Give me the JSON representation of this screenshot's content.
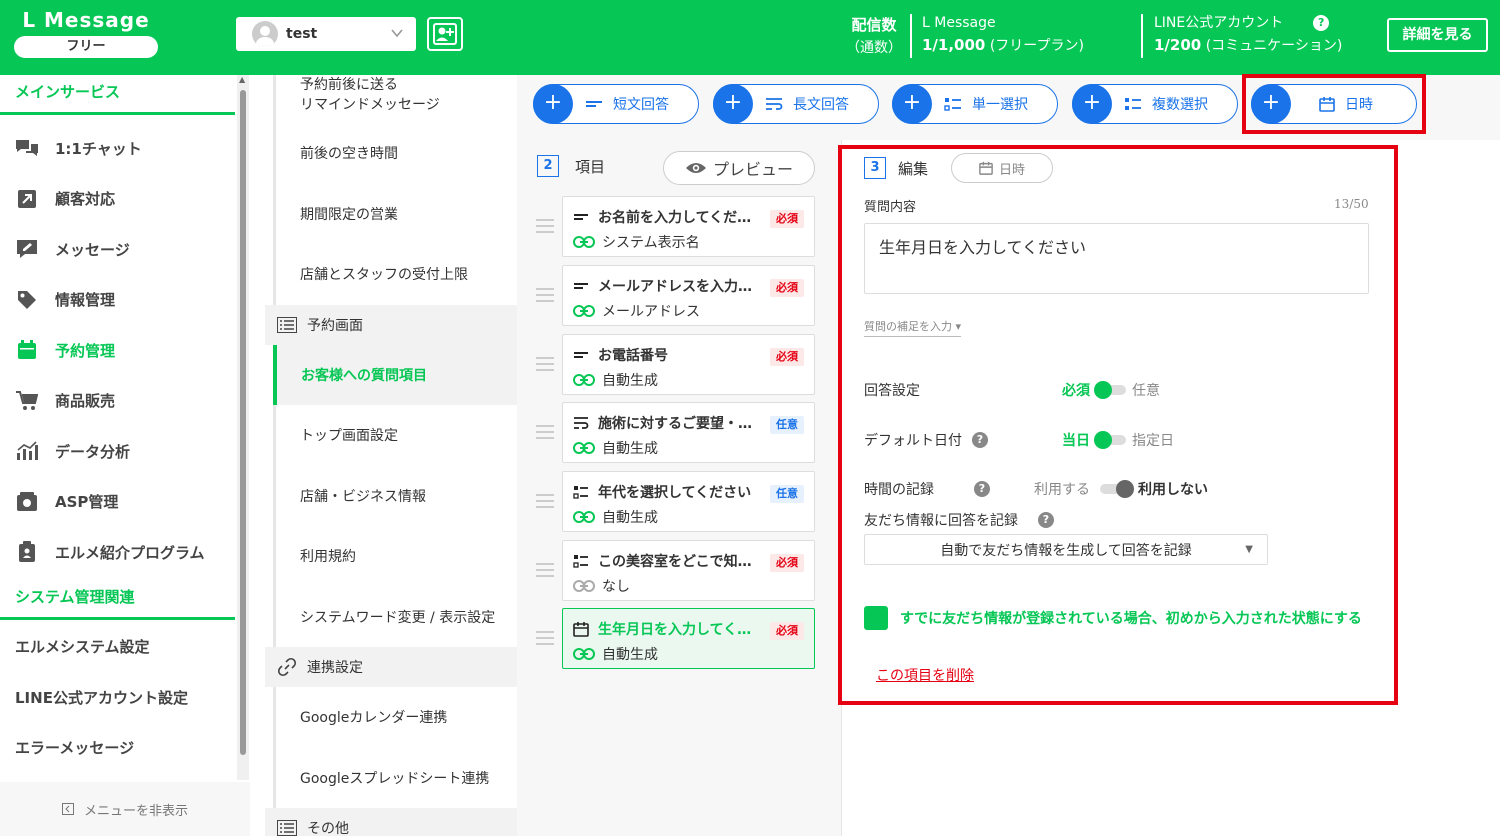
{
  "header": {
    "logo": "L Message",
    "plan_badge": "フリー",
    "account_name": "test",
    "delivery_label": "配信数",
    "delivery_sub": "（通数）",
    "lmessage_label": "L Message",
    "lmessage_value": "1/1,000",
    "lmessage_plan": "(フリープラン)",
    "line_label": "LINE公式アカウント",
    "line_value": "1/200",
    "line_plan": "(コミュニケーション)",
    "details_button": "詳細を見る"
  },
  "sidebar": {
    "section_main": "メインサービス",
    "items": [
      {
        "label": "1:1チャット",
        "icon": "chat-icon"
      },
      {
        "label": "顧客対応",
        "icon": "arrow-icon"
      },
      {
        "label": "メッセージ",
        "icon": "message-icon"
      },
      {
        "label": "情報管理",
        "icon": "tag-icon"
      },
      {
        "label": "予約管理",
        "icon": "calendar-icon"
      },
      {
        "label": "商品販売",
        "icon": "cart-icon"
      },
      {
        "label": "データ分析",
        "icon": "chart-icon"
      },
      {
        "label": "ASP管理",
        "icon": "asp-icon"
      },
      {
        "label": "エルメ紹介プログラム",
        "icon": "clipboard-icon"
      }
    ],
    "section_system": "システム管理関連",
    "system_items": [
      "エルメシステム設定",
      "LINE公式アカウント設定",
      "エラーメッセージ"
    ],
    "hide_menu": "メニューを非表示"
  },
  "submenu": {
    "remind_line1": "予約前後に送る",
    "remind_line2": "リマインドメッセージ",
    "items_a": [
      "前後の空き時間",
      "期間限定の営業",
      "店舗とスタッフの受付上限"
    ],
    "head_reservation": "予約画面",
    "active_item": "お客様への質問項目",
    "items_b": [
      "トップ画面設定",
      "店舗・ビジネス情報",
      "利用規約",
      "システムワード変更 / 表示設定"
    ],
    "head_integration": "連携設定",
    "items_c": [
      "Googleカレンダー連携",
      "Googleスプレッドシート連携"
    ],
    "head_other": "その他"
  },
  "type_buttons": [
    "短文回答",
    "長文回答",
    "単一選択",
    "複数選択",
    "日時"
  ],
  "items_panel": {
    "step": "2",
    "title": "項目",
    "preview": "プレビュー",
    "questions": [
      {
        "title": "お名前を入力してくだ…",
        "sub": "システム表示名",
        "badge": "必須"
      },
      {
        "title": "メールアドレスを入力…",
        "sub": "メールアドレス",
        "badge": "必須"
      },
      {
        "title": "お電話番号",
        "sub": "自動生成",
        "badge": "必須"
      },
      {
        "title": "施術に対するご要望・…",
        "sub": "自動生成",
        "badge": "任意"
      },
      {
        "title": "年代を選択してください",
        "sub": "自動生成",
        "badge": "任意"
      },
      {
        "title": "この美容室をどこで知…",
        "sub": "なし",
        "badge": "必須"
      },
      {
        "title": "生年月日を入力してく…",
        "sub": "自動生成",
        "badge": "必須"
      }
    ]
  },
  "edit_panel": {
    "step": "3",
    "title": "編集",
    "type_chip": "日時",
    "question_label": "質問内容",
    "counter": "13/50",
    "question_text": "生年月日を入力してください",
    "supplement_link": "質問の補足を入力",
    "answer_setting": "回答設定",
    "answer_on": "必須",
    "answer_off": "任意",
    "default_date": "デフォルト日付",
    "default_on": "当日",
    "default_off": "指定日",
    "time_record": "時間の記録",
    "time_on": "利用する",
    "time_off": "利用しない",
    "friend_record": "友だち情報に回答を記録",
    "friend_select": "自動で友だち情報を生成して回答を記録",
    "checkbox_label": "すでに友だち情報が登録されている場合、初めから入力された状態にする",
    "delete_link": "この項目を削除"
  },
  "colors": {
    "brand": "#06c755",
    "accent": "#1a73e8",
    "highlight": "#e50012"
  }
}
